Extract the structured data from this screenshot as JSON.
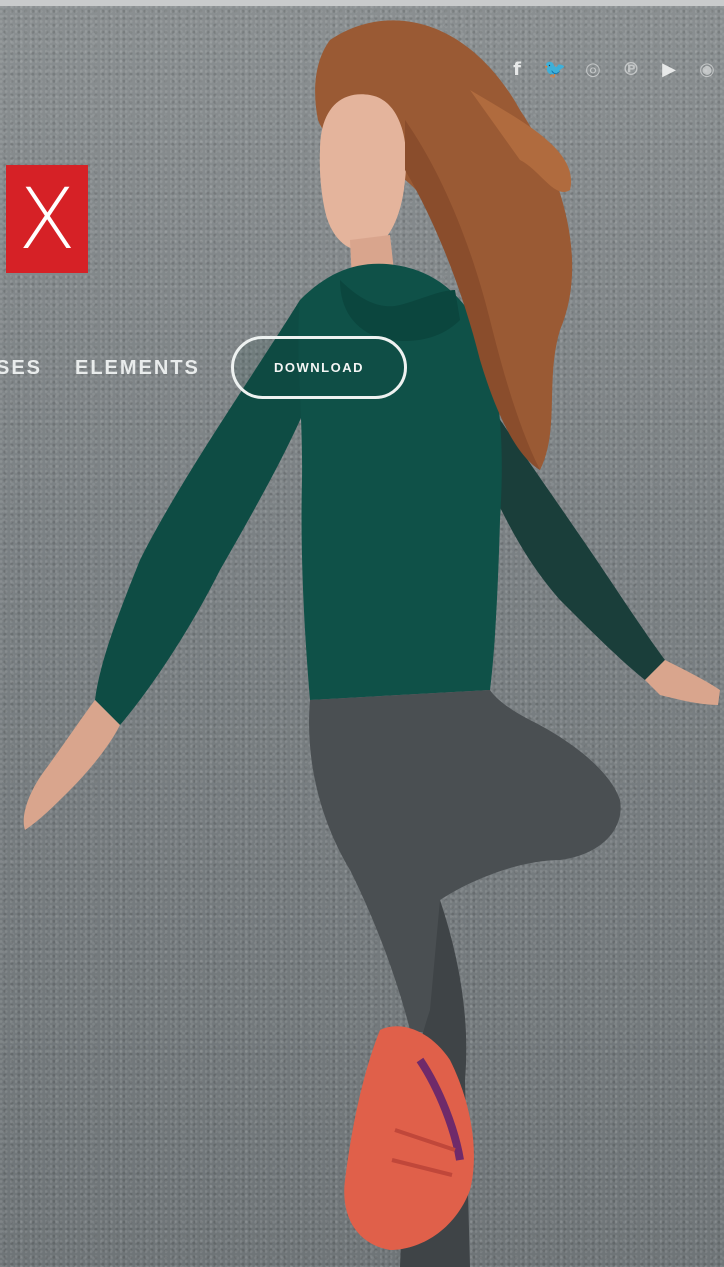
{
  "social": {
    "icons": [
      {
        "name": "facebook-icon",
        "glyph": "f"
      },
      {
        "name": "twitter-icon",
        "glyph": "🐦"
      },
      {
        "name": "instagram-icon",
        "glyph": "◎"
      },
      {
        "name": "pinterest-icon",
        "glyph": "℗"
      },
      {
        "name": "youtube-icon",
        "glyph": "▶"
      },
      {
        "name": "dribbble-icon",
        "glyph": "◉"
      }
    ]
  },
  "logo": {
    "letter": "X",
    "color": "#d62126"
  },
  "nav": {
    "partial_label": "SES",
    "elements_label": "ELEMENTS",
    "download_label": "DOWNLOAD"
  },
  "colors": {
    "background": "#7c8183",
    "hoodie": "#0f5148",
    "leggings": "#4a4f52",
    "hair": "#9a5a34",
    "shoe": "#e0604a"
  }
}
